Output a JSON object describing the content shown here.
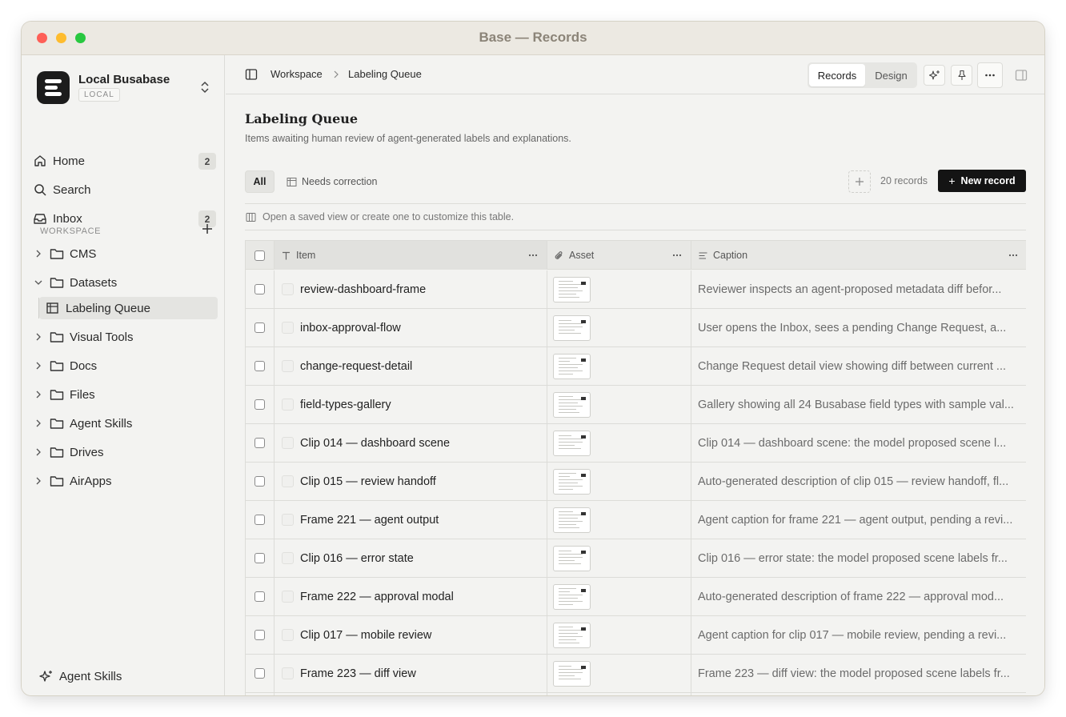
{
  "window": {
    "title": "Base — Records"
  },
  "sidebar": {
    "workspace_name": "Local Busabase",
    "workspace_badge": "LOCAL",
    "nav": [
      {
        "label": "Home",
        "icon": "home-icon",
        "count": "2"
      },
      {
        "label": "Search",
        "icon": "search-icon",
        "count": null
      },
      {
        "label": "Inbox",
        "icon": "inbox-icon",
        "count": "2"
      }
    ],
    "section_label": "WORKSPACE",
    "tree": [
      {
        "label": "CMS",
        "expanded": false
      },
      {
        "label": "Datasets",
        "expanded": true
      },
      {
        "label": "Labeling Queue",
        "child": true,
        "active": true
      },
      {
        "label": "Visual Tools",
        "expanded": false
      },
      {
        "label": "Docs",
        "expanded": false
      },
      {
        "label": "Files",
        "expanded": false
      },
      {
        "label": "Agent Skills",
        "expanded": false
      },
      {
        "label": "Drives",
        "expanded": false
      },
      {
        "label": "AirApps",
        "expanded": false
      }
    ],
    "footer_label": "Agent Skills"
  },
  "topbar": {
    "breadcrumb": [
      "Workspace",
      "Labeling Queue"
    ],
    "tabs": [
      "Records",
      "Design"
    ],
    "active_tab": "Records"
  },
  "page": {
    "title": "Labeling Queue",
    "description": "Items awaiting human review of agent-generated labels and explanations.",
    "views": [
      "All",
      "Needs correction"
    ],
    "record_count": "20 records",
    "new_record_label": "New record",
    "hint": "Open a saved view or create one to customize this table."
  },
  "table": {
    "columns": [
      "Item",
      "Asset",
      "Caption"
    ],
    "rows": [
      {
        "item": "review-dashboard-frame",
        "caption": "Reviewer inspects an agent-proposed metadata diff befor..."
      },
      {
        "item": "inbox-approval-flow",
        "caption": "User opens the Inbox, sees a pending Change Request, a..."
      },
      {
        "item": "change-request-detail",
        "caption": "Change Request detail view showing diff between current ..."
      },
      {
        "item": "field-types-gallery",
        "caption": "Gallery showing all 24 Busabase field types with sample val..."
      },
      {
        "item": "Clip 014 — dashboard scene",
        "caption": "Clip 014 — dashboard scene: the model proposed scene l..."
      },
      {
        "item": "Clip 015 — review handoff",
        "caption": "Auto-generated description of clip 015 — review handoff, fl..."
      },
      {
        "item": "Frame 221 — agent output",
        "caption": "Agent caption for frame 221 — agent output, pending a revi..."
      },
      {
        "item": "Clip 016 — error state",
        "caption": "Clip 016 — error state: the model proposed scene labels fr..."
      },
      {
        "item": "Frame 222 — approval modal",
        "caption": "Auto-generated description of frame 222 — approval mod..."
      },
      {
        "item": "Clip 017 — mobile review",
        "caption": "Agent caption for clip 017 — mobile review, pending a revi..."
      },
      {
        "item": "Frame 223 — diff view",
        "caption": "Frame 223 — diff view: the model proposed scene labels fr..."
      },
      {
        "item": "",
        "caption": ""
      }
    ]
  }
}
